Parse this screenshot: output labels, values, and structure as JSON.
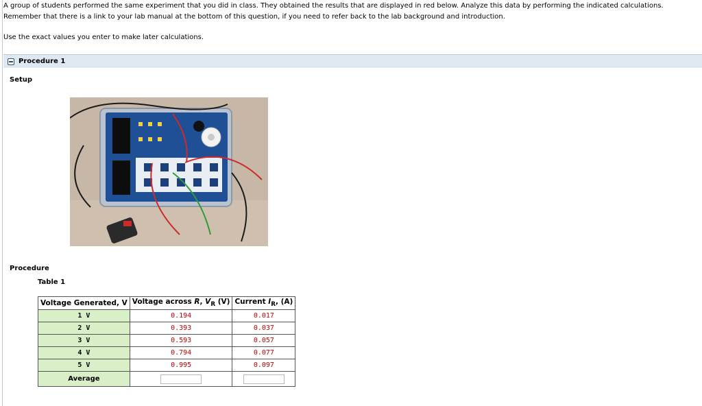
{
  "intro": {
    "line1": "A group of students performed the same experiment that you did in class. They obtained the results that are displayed in red below. Analyze this data by performing the indicated calculations.",
    "line2": "Remember that there is a link to your lab manual at the bottom of this question, if you need to refer back to the lab background and introduction."
  },
  "note": "Use the exact values you enter to make later calculations.",
  "procedure_header": "Procedure 1",
  "setup_label": "Setup",
  "procedure_label": "Procedure",
  "table": {
    "title": "Table 1",
    "headers": {
      "col1": "Voltage Generated, V",
      "col2_a": "Voltage across",
      "col2_r": "R",
      "col2_vr": "V",
      "col2_sub": "R",
      "col2_unit": "(V)",
      "col3_a": "Current",
      "col3_i": "I",
      "col3_sub": "R",
      "col3_unit": "(A)"
    },
    "rows": [
      {
        "gen": "1 V",
        "vr": "0.194",
        "ir": "0.017"
      },
      {
        "gen": "2 V",
        "vr": "0.393",
        "ir": "0.037"
      },
      {
        "gen": "3 V",
        "vr": "0.593",
        "ir": "0.057"
      },
      {
        "gen": "4 V",
        "vr": "0.794",
        "ir": "0.077"
      },
      {
        "gen": "5 V",
        "vr": "0.995",
        "ir": "0.097"
      }
    ],
    "average_label": "Average"
  }
}
